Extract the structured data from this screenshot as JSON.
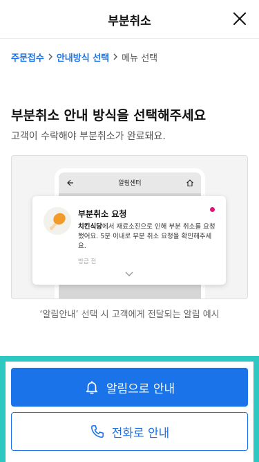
{
  "header": {
    "title": "부분취소"
  },
  "breadcrumb": {
    "step1": "주문접수",
    "step2": "안내방식 선택",
    "step3": "메뉴 선택"
  },
  "main": {
    "headline": "부분취소 안내 방식을 선택해주세요",
    "subline": "고객이 수락해야 부분취소가 완료돼요.",
    "caption": "‘알림안내’ 선택 시 고객에게 전달되는 알림 예시"
  },
  "preview": {
    "screen_title": "알림센터",
    "notice": {
      "title": "부분취소 요청",
      "store": "치킨식당",
      "body": "에서 재료소진으로 인해 부분 취소를 요청했어요. 5분 이내로 부분 취소 요청을 확인해주세요.",
      "time": "방금 전"
    }
  },
  "actions": {
    "notify_label": "알림으로 안내",
    "phone_label": "전화로 안내"
  },
  "colors": {
    "accent": "#1a73e8",
    "highlight": "#2ec8c2",
    "unread_dot": "#e0137a"
  },
  "icons": {
    "close": "close-icon",
    "breadcrumb_separator": "chevron-right-icon",
    "bell": "bell-icon",
    "phone": "phone-icon"
  }
}
